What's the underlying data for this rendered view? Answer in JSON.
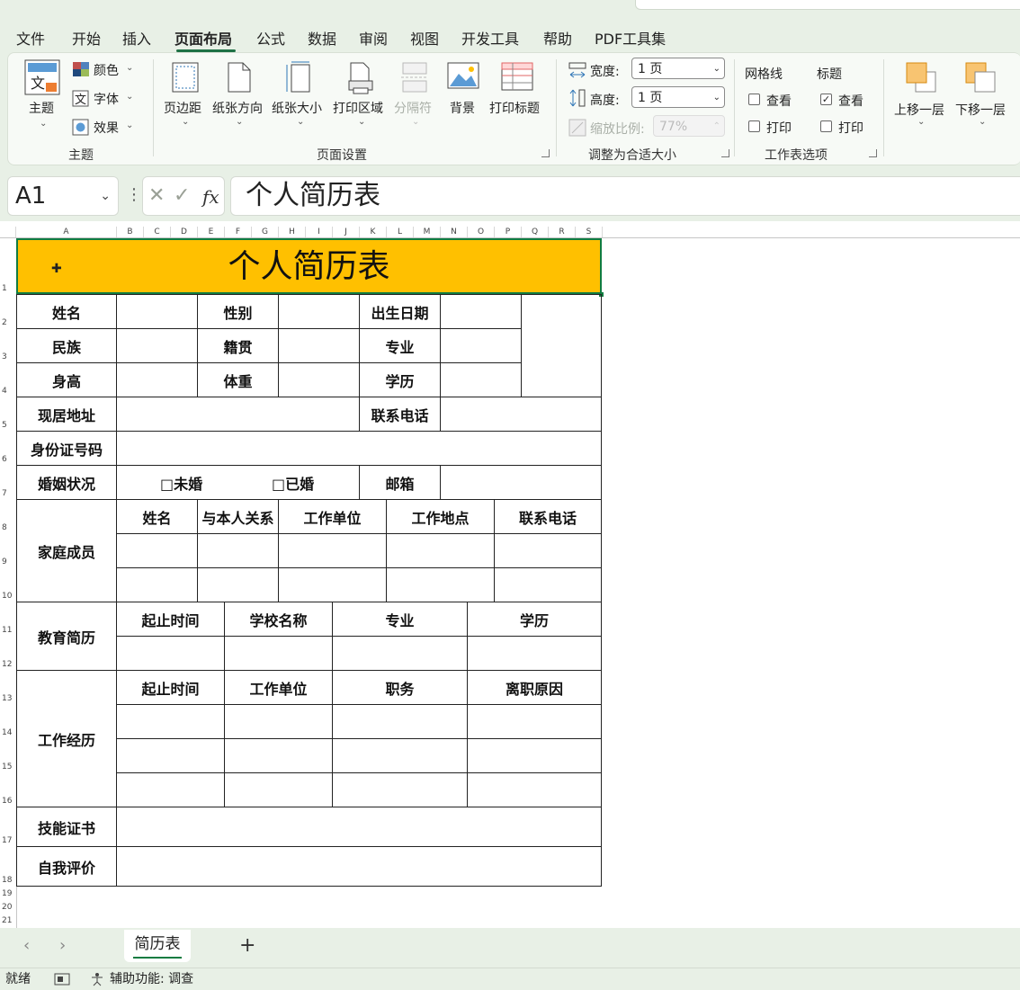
{
  "menu": {
    "items": [
      "文件",
      "开始",
      "插入",
      "页面布局",
      "公式",
      "数据",
      "审阅",
      "视图",
      "开发工具",
      "帮助",
      "PDF工具集"
    ],
    "active": "页面布局"
  },
  "ribbon": {
    "theme": {
      "main_label": "主题",
      "colors_label": "颜色",
      "fonts_label": "字体",
      "effects_label": "效果",
      "group_label": "主题"
    },
    "page_setup": {
      "margins_label": "页边距",
      "orientation_label": "纸张方向",
      "size_label": "纸张大小",
      "print_area_label": "打印区域",
      "breaks_label": "分隔符",
      "background_label": "背景",
      "print_titles_label": "打印标题",
      "group_label": "页面设置"
    },
    "scale": {
      "width_label": "宽度:",
      "width_value": "1 页",
      "height_label": "高度:",
      "height_value": "1 页",
      "scale_label": "缩放比例:",
      "scale_value": "77%",
      "group_label": "调整为合适大小"
    },
    "sheet_options": {
      "gridlines_label": "网格线",
      "headings_label": "标题",
      "view_label": "查看",
      "print_label": "打印",
      "group_label": "工作表选项"
    },
    "arrange": {
      "bring_forward_label": "上移一层",
      "send_backward_label": "下移一层"
    }
  },
  "formula_bar": {
    "name_box": "A1",
    "formula": "个人简历表"
  },
  "columns": [
    "A",
    "B",
    "C",
    "D",
    "E",
    "F",
    "G",
    "H",
    "I",
    "J",
    "K",
    "L",
    "M",
    "N",
    "O",
    "P",
    "Q",
    "R",
    "S"
  ],
  "rows": [
    "1",
    "2",
    "3",
    "4",
    "5",
    "6",
    "7",
    "8",
    "9",
    "10",
    "11",
    "12",
    "13",
    "14",
    "15",
    "16",
    "17",
    "18",
    "19",
    "20",
    "21"
  ],
  "resume": {
    "title": "个人简历表",
    "name": "姓名",
    "gender": "性别",
    "birth_date": "出生日期",
    "ethnicity": "民族",
    "native_place": "籍贯",
    "major": "专业",
    "height": "身高",
    "weight": "体重",
    "education": "学历",
    "address": "现居地址",
    "phone": "联系电话",
    "id_number": "身份证号码",
    "marital_status": "婚姻状况",
    "unmarried": "□未婚",
    "married": "□已婚",
    "email": "邮箱",
    "family": {
      "label": "家庭成员",
      "headers": [
        "姓名",
        "与本人关系",
        "工作单位",
        "工作地点",
        "联系电话"
      ]
    },
    "education_history": {
      "label": "教育简历",
      "headers": [
        "起止时间",
        "学校名称",
        "专业",
        "学历"
      ]
    },
    "work_history": {
      "label": "工作经历",
      "headers": [
        "起止时间",
        "工作单位",
        "职务",
        "离职原因"
      ]
    },
    "skills": "技能证书",
    "self_evaluation": "自我评价"
  },
  "sheet_tabs": {
    "active": "简历表",
    "add_symbol": "+"
  },
  "status": {
    "ready": "就绪",
    "accessibility": "辅助功能: 调查"
  }
}
